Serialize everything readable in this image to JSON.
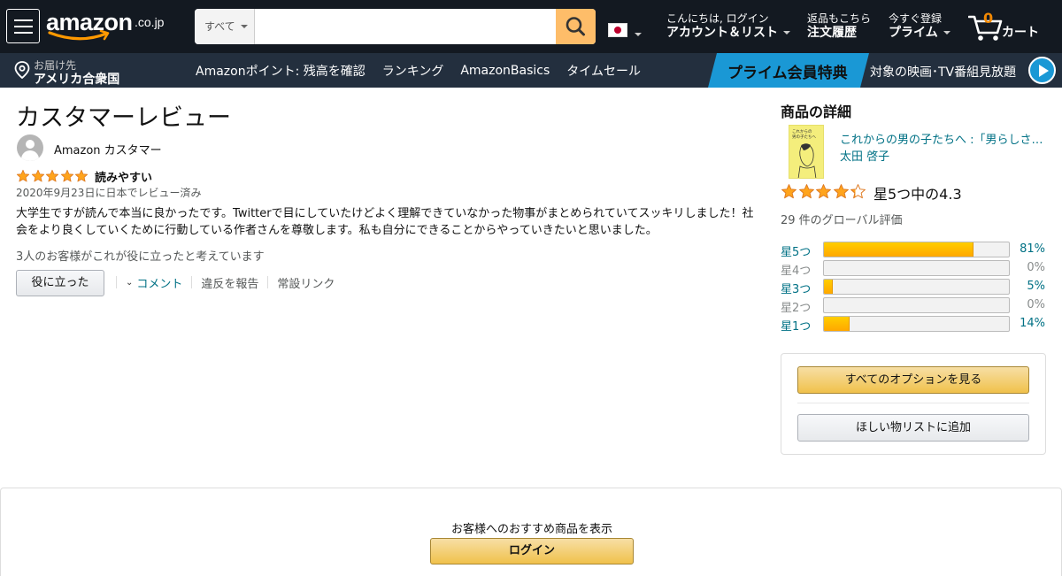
{
  "header": {
    "logo_text": "amazon",
    "logo_suffix": ".co.jp",
    "search": {
      "category": "すべて",
      "placeholder": "",
      "value": ""
    },
    "account": {
      "line1": "こんにちは, ログイン",
      "line2": "アカウント＆リスト"
    },
    "orders": {
      "line1": "返品もこちら",
      "line2": "注文履歴"
    },
    "prime": {
      "line1": "今すぐ登録",
      "line2": "プライム"
    },
    "cart": {
      "count": "0",
      "label": "カート"
    }
  },
  "subnav": {
    "deliver_line1": "お届け先",
    "deliver_line2": "アメリカ合衆国",
    "links": [
      "Amazonポイント: 残高を確認",
      "ランキング",
      "AmazonBasics",
      "タイムセール"
    ],
    "prime_banner_title": "プライム会員特典",
    "prime_banner_text": "対象の映画･TV番組見放題"
  },
  "review": {
    "page_title": "カスタマーレビュー",
    "reviewer_name": "Amazon カスタマー",
    "rating": 5,
    "title": "読みやすい",
    "date": "2020年9月23日に日本でレビュー済み",
    "body": "大学生ですが読んで本当に良かったです。Twitterで目にしていたけどよく理解できていなかった物事がまとめられていてスッキリしました！社会をより良くしていくために行動している作者さんを尊敬します。私も自分にできることからやっていきたいと思いました。",
    "helpful_count_text": "3人のお客様がこれが役に立ったと考えています",
    "helpful_button": "役に立った",
    "comment_link": "コメント",
    "report_link": "違反を報告",
    "permalink": "常設リンク"
  },
  "product": {
    "section_title": "商品の詳細",
    "title": "これからの男の子たちへ :「男らしさ」から自由になるためのレッスン",
    "author": "太田 啓子",
    "average_rating": 4.3,
    "rating_text": "星5つ中の4.3",
    "global_ratings": "29 件のグローバル評価",
    "histogram": [
      {
        "label": "星5つ",
        "percent": 81,
        "percent_text": "81%",
        "active": true
      },
      {
        "label": "星4つ",
        "percent": 0,
        "percent_text": "0%",
        "active": false
      },
      {
        "label": "星3つ",
        "percent": 5,
        "percent_text": "5%",
        "active": true
      },
      {
        "label": "星2つ",
        "percent": 0,
        "percent_text": "0%",
        "active": false
      },
      {
        "label": "星1つ",
        "percent": 14,
        "percent_text": "14%",
        "active": true
      }
    ],
    "see_options_button": "すべてのオプションを見る",
    "wishlist_button": "ほしい物リストに追加"
  },
  "signin": {
    "text": "お客様へのおすすめ商品を表示",
    "button": "ログイン"
  },
  "colors": {
    "nav_dark": "#131921",
    "nav_sub": "#232f3e",
    "search_button": "#febd69",
    "star": "#ffa41c",
    "link": "#007185",
    "prime_blue": "#1a98d5"
  }
}
